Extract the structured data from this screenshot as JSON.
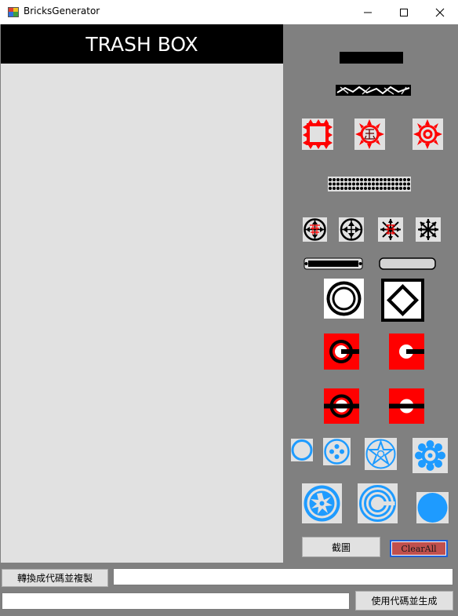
{
  "window": {
    "title": "BricksGenerator",
    "controls": [
      "minimize",
      "maximize",
      "close"
    ]
  },
  "trash_box": {
    "header": "TRASH BOX"
  },
  "palette": {
    "bricks": [
      {
        "name": "black-bar",
        "icon": "black-bar-icon"
      },
      {
        "name": "cracked-bar",
        "icon": "cracked-bar-icon"
      },
      {
        "name": "red-spiked-square",
        "icon": "red-spiked-square-icon"
      },
      {
        "name": "red-spiked-glyph",
        "icon": "red-spiked-glyph-icon"
      },
      {
        "name": "red-spiked-target",
        "icon": "red-spiked-target-icon"
      },
      {
        "name": "dotted-bar",
        "icon": "dotted-bar-icon"
      },
      {
        "name": "arrow-glyph-red",
        "icon": "arrow-glyph-red-icon"
      },
      {
        "name": "arrow-compass",
        "icon": "arrow-compass-icon"
      },
      {
        "name": "star-glyph-red",
        "icon": "star-glyph-red-icon"
      },
      {
        "name": "asterisk-arrows",
        "icon": "asterisk-arrows-icon"
      },
      {
        "name": "black-capsule",
        "icon": "black-capsule-icon"
      },
      {
        "name": "gray-capsule",
        "icon": "gray-capsule-icon"
      },
      {
        "name": "double-ring",
        "icon": "double-ring-icon"
      },
      {
        "name": "diamond-frame",
        "icon": "diamond-frame-icon"
      },
      {
        "name": "red-ring-right",
        "icon": "red-ring-right-icon"
      },
      {
        "name": "red-dot-right",
        "icon": "red-dot-right-icon"
      },
      {
        "name": "red-ring-bar",
        "icon": "red-ring-bar-icon"
      },
      {
        "name": "red-dot-bar",
        "icon": "red-dot-bar-icon"
      },
      {
        "name": "blue-ring",
        "icon": "blue-ring-icon"
      },
      {
        "name": "blue-button",
        "icon": "blue-button-icon"
      },
      {
        "name": "blue-star-flower",
        "icon": "blue-star-flower-icon"
      },
      {
        "name": "blue-snowflake",
        "icon": "blue-snowflake-icon"
      },
      {
        "name": "blue-burst",
        "icon": "blue-burst-icon"
      },
      {
        "name": "blue-concentric",
        "icon": "blue-concentric-icon"
      },
      {
        "name": "blue-disc",
        "icon": "blue-disc-icon"
      }
    ],
    "colors": {
      "red": "#ff0000",
      "blue": "#1e9bff",
      "black": "#000000",
      "tile": "#e1e1e1"
    }
  },
  "buttons": {
    "screenshot": "截圖",
    "clear_all": "ClearAll",
    "convert_copy": "轉換成代碼並複製",
    "use_code_generate": "使用代碼並生成"
  },
  "inputs": {
    "code_output": {
      "value": "",
      "placeholder": ""
    },
    "code_input": {
      "value": "",
      "placeholder": ""
    }
  }
}
